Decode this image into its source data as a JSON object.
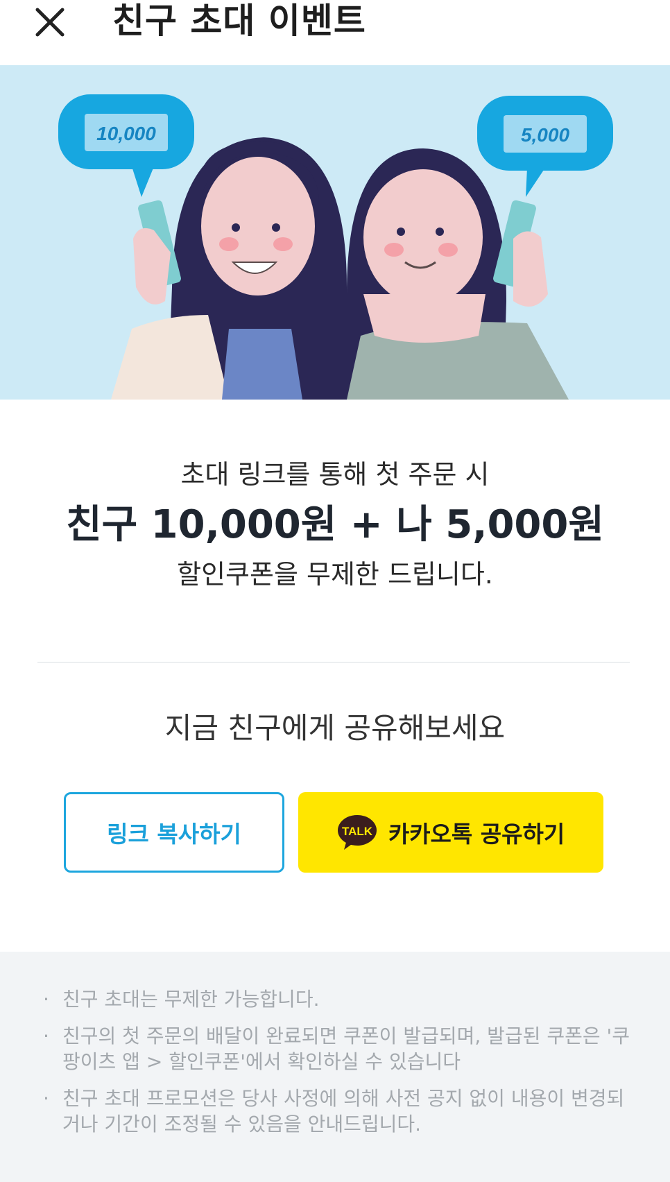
{
  "header": {
    "title": "친구 초대 이벤트",
    "close_icon": "close-icon"
  },
  "hero": {
    "coupon_left": "10,000",
    "coupon_right": "5,000",
    "background": "#cdeaf6"
  },
  "promo": {
    "line1": "초대 링크를 통해 첫 주문 시",
    "line2": "친구 10,000원 + 나 5,000원",
    "line3": "할인쿠폰을 무제한 드립니다."
  },
  "share": {
    "title": "지금 친구에게 공유해보세요",
    "copy_button_label": "링크 복사하기",
    "kakao_button_label": "카카오톡 공유하기",
    "kakao_icon_text": "TALK",
    "kakao_icon": "kakaotalk-icon",
    "copy_color": "#1da6de",
    "kakao_color": "#ffe600"
  },
  "notice": {
    "items": [
      "친구 초대는 무제한 가능합니다.",
      "친구의 첫 주문의 배달이 완료되면 쿠폰이 발급되며, 발급된 쿠폰은 '쿠팡이츠 앱 > 할인쿠폰'에서 확인하실 수 있습니다",
      "친구 초대 프로모션은 당사 사정에 의해 사전 공지 없이 내용이 변경되거나 기간이 조정될 수 있음을 안내드립니다."
    ]
  }
}
